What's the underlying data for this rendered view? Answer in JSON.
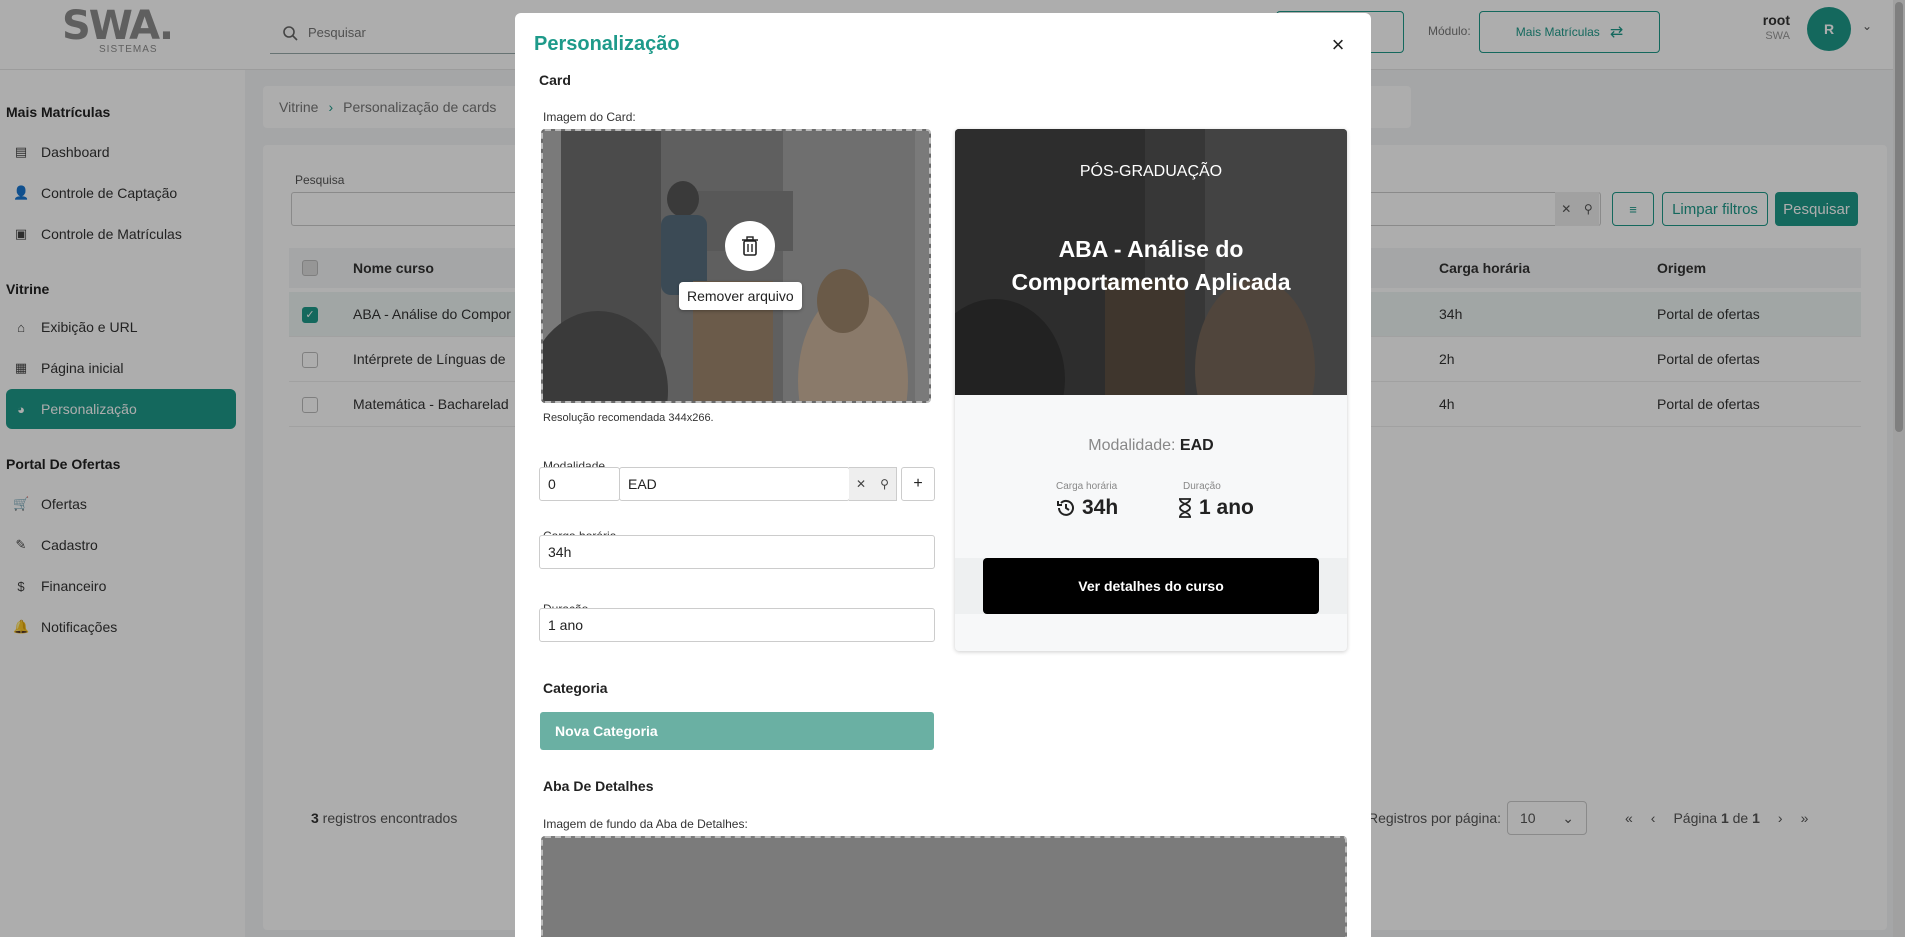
{
  "app": {
    "logo_text": "SWA.",
    "logo_sub": "SISTEMAS",
    "search_placeholder": "Pesquisar",
    "module_label": "Módulo:",
    "module_value": "Mais Matrículas",
    "user_name": "root",
    "user_org": "SWA",
    "avatar_initial": "R"
  },
  "sidebar": {
    "sections": [
      {
        "title": "Mais Matrículas",
        "items": [
          {
            "label": "Dashboard",
            "icon": "dashboard-icon"
          },
          {
            "label": "Controle de Captação",
            "icon": "user-plus-icon"
          },
          {
            "label": "Controle de Matrículas",
            "icon": "enrollment-icon"
          }
        ]
      },
      {
        "title": "Vitrine",
        "items": [
          {
            "label": "Exibição e URL",
            "icon": "storefront-icon"
          },
          {
            "label": "Página inicial",
            "icon": "grid-icon"
          },
          {
            "label": "Personalização",
            "icon": "palette-icon"
          }
        ]
      },
      {
        "title": "Portal De Ofertas",
        "items": [
          {
            "label": "Ofertas",
            "icon": "cart-icon"
          },
          {
            "label": "Cadastro",
            "icon": "user-edit-icon"
          },
          {
            "label": "Financeiro",
            "icon": "dollar-icon"
          },
          {
            "label": "Notificações",
            "icon": "bell-icon"
          }
        ]
      }
    ]
  },
  "breadcrumb": {
    "root": "Vitrine",
    "current": "Personalização de cards"
  },
  "filters": {
    "search_label": "Pesquisa",
    "clear_label": "Limpar filtros",
    "search_button": "Pesquisar"
  },
  "table": {
    "columns": [
      "Nome curso",
      "Carga horária",
      "Origem"
    ],
    "rows": [
      {
        "name": "ABA - Análise do Compor",
        "hours": "34h",
        "origin": "Portal de ofertas",
        "selected": true
      },
      {
        "name": "Intérprete de Línguas de",
        "hours": "2h",
        "origin": "Portal de ofertas",
        "selected": false
      },
      {
        "name": "Matemática - Bacharelad",
        "hours": "4h",
        "origin": "Portal de ofertas",
        "selected": false
      }
    ],
    "count_number": "3",
    "count_text": " registros encontrados",
    "per_page_label": "Registros por página:",
    "per_page_value": "10",
    "page_prefix": "Página",
    "page_current": "1",
    "page_sep": "de",
    "page_total": "1"
  },
  "modal": {
    "title": "Personalização",
    "card_section": "Card",
    "card_image_label": "Imagem do Card:",
    "remove_file": "Remover arquivo",
    "resolution_hint": "Resolução recomendada 344x266.",
    "modalidade_label": "Modalidade",
    "modalidade_code": "0",
    "modalidade_value": "EAD",
    "carga_label": "Carga horária",
    "carga_value": "34h",
    "duracao_label": "Duração",
    "duracao_value": "1 ano",
    "categoria_label": "Categoria",
    "nova_categoria": "Nova Categoria",
    "aba_label": "Aba De Detalhes",
    "aba_image_label": "Imagem de fundo da Aba de Detalhes:"
  },
  "preview": {
    "category": "PÓS-GRADUAÇÃO",
    "title": "ABA - Análise do Comportamento Aplicada",
    "modalidade_prefix": "Modalidade:",
    "modalidade_value": "EAD",
    "carga_small": "Carga horária",
    "carga_value": "34h",
    "duracao_small": "Duração",
    "duracao_value": "1 ano",
    "button": "Ver detalhes do curso"
  },
  "colors": {
    "accent": "#1e9a8a",
    "category_button": "#6ab0a3",
    "preview_button": "#000000"
  }
}
